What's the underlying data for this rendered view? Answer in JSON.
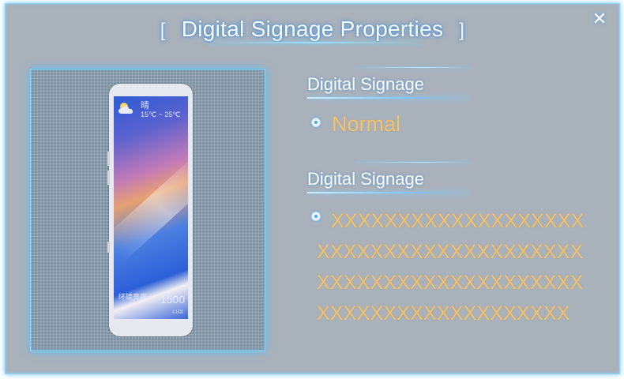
{
  "dialog": {
    "title": "Digital Signage Properties",
    "bracket_left": "[",
    "bracket_right": "]",
    "close_glyph": "✕"
  },
  "preview": {
    "weather": {
      "condition": "晴",
      "temperature": "15℃ ~ 25℃",
      "icon": "cloud-sun-icon"
    },
    "ambient_label": "环境亮度",
    "lux_value": "1500",
    "lux_unit": "LUX"
  },
  "sections": [
    {
      "label": "Digital Signage",
      "value": "Normal"
    },
    {
      "label": "Digital Signage",
      "value": "XXXXXXXXXXXXXXXXXXXXXXXXXXXXXXXXXXXXXXXXXXXXXXXXXXXXXXXXXXXXXXXXXXXXXXXXXXXXXX"
    }
  ],
  "colors": {
    "panel_bg": "#a9b1bb",
    "accent_glow": "#7fd0ff",
    "value_text": "#f4c26a",
    "label_text": "#ffffff"
  }
}
